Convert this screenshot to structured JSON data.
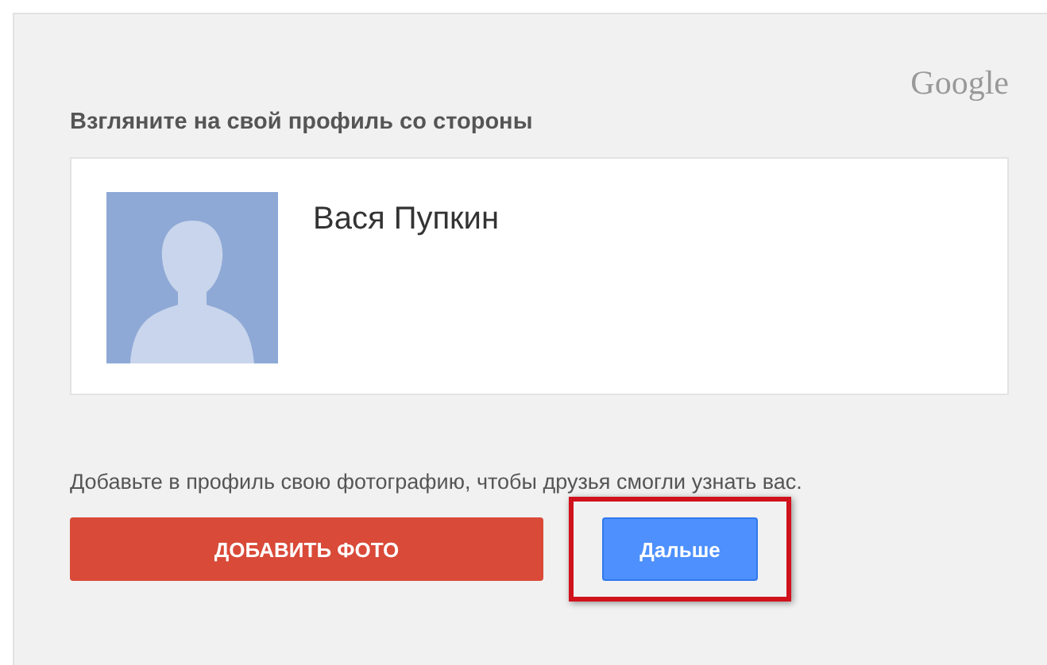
{
  "logo": "Google",
  "title": "Взгляните на свой профиль со стороны",
  "profile": {
    "name": "Вася Пупкин"
  },
  "hint": "Добавьте в профиль свою фотографию, чтобы друзья смогли узнать вас.",
  "buttons": [
    {
      "label": "ДОБАВИТЬ ФОТО",
      "kind": "red",
      "highlighted": false
    },
    {
      "label": "Дальше",
      "kind": "blue",
      "highlighted": true
    }
  ]
}
